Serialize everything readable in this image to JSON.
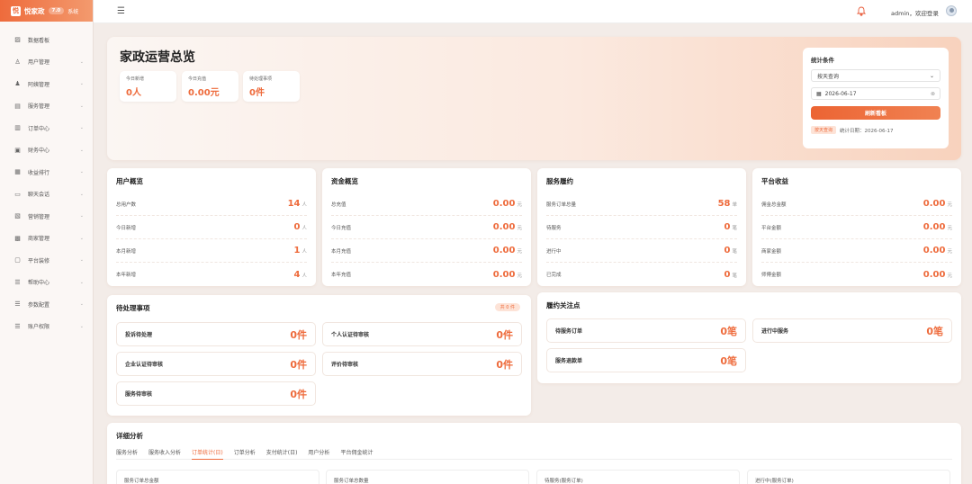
{
  "logo": {
    "mark": "悦",
    "name": "悦家政",
    "version": "7.0",
    "suffix": "系统"
  },
  "sidebar": {
    "items": [
      {
        "label": "数据看板",
        "icon": "chart-line-icon",
        "glyph": "▨"
      },
      {
        "label": "用户管理",
        "icon": "user-icon",
        "glyph": "♙"
      },
      {
        "label": "阿姨管理",
        "icon": "nanny-icon",
        "glyph": "♟"
      },
      {
        "label": "服务管理",
        "icon": "service-icon",
        "glyph": "▤"
      },
      {
        "label": "订单中心",
        "icon": "order-icon",
        "glyph": "▥"
      },
      {
        "label": "财务中心",
        "icon": "wallet-icon",
        "glyph": "▣"
      },
      {
        "label": "收益排行",
        "icon": "bar-chart-icon",
        "glyph": "▦"
      },
      {
        "label": "聊天会话",
        "icon": "chat-icon",
        "glyph": "▭"
      },
      {
        "label": "营销管理",
        "icon": "coupon-icon",
        "glyph": "▧"
      },
      {
        "label": "商家管理",
        "icon": "shop-icon",
        "glyph": "▩"
      },
      {
        "label": "平台装修",
        "icon": "layout-icon",
        "glyph": "▢"
      },
      {
        "label": "帮助中心",
        "icon": "help-icon",
        "glyph": "☰"
      },
      {
        "label": "参数配置",
        "icon": "settings-icon",
        "glyph": "☰"
      },
      {
        "label": "账户权限",
        "icon": "permission-icon",
        "glyph": "☰"
      }
    ]
  },
  "header": {
    "user_text": "admin，欢迎登录"
  },
  "hero": {
    "title": "家政运营总览",
    "stats": [
      {
        "label": "今日新增",
        "value": "0人"
      },
      {
        "label": "今日充值",
        "value": "0.00元"
      },
      {
        "label": "待处理事项",
        "value": "0件"
      }
    ]
  },
  "condition": {
    "title": "统计条件",
    "mode_value": "按天查询",
    "date_value": "2026-06-17",
    "refresh_label": "刷新看板",
    "tag": "按天查询",
    "date_line": "统计日期：2026-06-17"
  },
  "overviews": [
    {
      "title": "用户概览",
      "rows": [
        {
          "label": "总用户数",
          "value": "14",
          "unit": "人"
        },
        {
          "label": "今日新增",
          "value": "0",
          "unit": "人"
        },
        {
          "label": "本月新增",
          "value": "1",
          "unit": "人"
        },
        {
          "label": "本年新增",
          "value": "4",
          "unit": "人"
        }
      ]
    },
    {
      "title": "资金概览",
      "rows": [
        {
          "label": "总充值",
          "value": "0.00",
          "unit": "元"
        },
        {
          "label": "今日充值",
          "value": "0.00",
          "unit": "元"
        },
        {
          "label": "本月充值",
          "value": "0.00",
          "unit": "元"
        },
        {
          "label": "本年充值",
          "value": "0.00",
          "unit": "元"
        }
      ]
    },
    {
      "title": "服务履约",
      "rows": [
        {
          "label": "服务订单总量",
          "value": "58",
          "unit": "单"
        },
        {
          "label": "待服务",
          "value": "0",
          "unit": "笔"
        },
        {
          "label": "进行中",
          "value": "0",
          "unit": "笔"
        },
        {
          "label": "已完成",
          "value": "0",
          "unit": "笔"
        }
      ]
    },
    {
      "title": "平台收益",
      "rows": [
        {
          "label": "佣金总金额",
          "value": "0.00",
          "unit": "元"
        },
        {
          "label": "平台金额",
          "value": "0.00",
          "unit": "元"
        },
        {
          "label": "商家金额",
          "value": "0.00",
          "unit": "元"
        },
        {
          "label": "师傅金额",
          "value": "0.00",
          "unit": "元"
        }
      ]
    }
  ],
  "pending": {
    "title": "待处理事项",
    "badge": "共 0 件",
    "tasks": [
      {
        "label": "投诉待处理",
        "value": "0件"
      },
      {
        "label": "个人认证待审核",
        "value": "0件"
      },
      {
        "label": "企业认证待审核",
        "value": "0件"
      },
      {
        "label": "评价待审核",
        "value": "0件"
      },
      {
        "label": "服务待审核",
        "value": "0件"
      }
    ]
  },
  "care": {
    "title": "履约关注点",
    "items": [
      {
        "label": "待服务订单",
        "value": "0笔"
      },
      {
        "label": "进行中服务",
        "value": "0笔"
      },
      {
        "label": "服务退款单",
        "value": "0笔"
      }
    ]
  },
  "detail": {
    "title": "详细分析",
    "tabs": [
      "服务分析",
      "服务收入分析",
      "订单统计(日)",
      "订单分析",
      "支付统计(日)",
      "用户分析",
      "平台佣金统计"
    ],
    "active_tab": 2,
    "cards": [
      "服务订单总金额",
      "服务订单总数量",
      "待服务(服务订单)",
      "进行中(服务订单)"
    ]
  }
}
